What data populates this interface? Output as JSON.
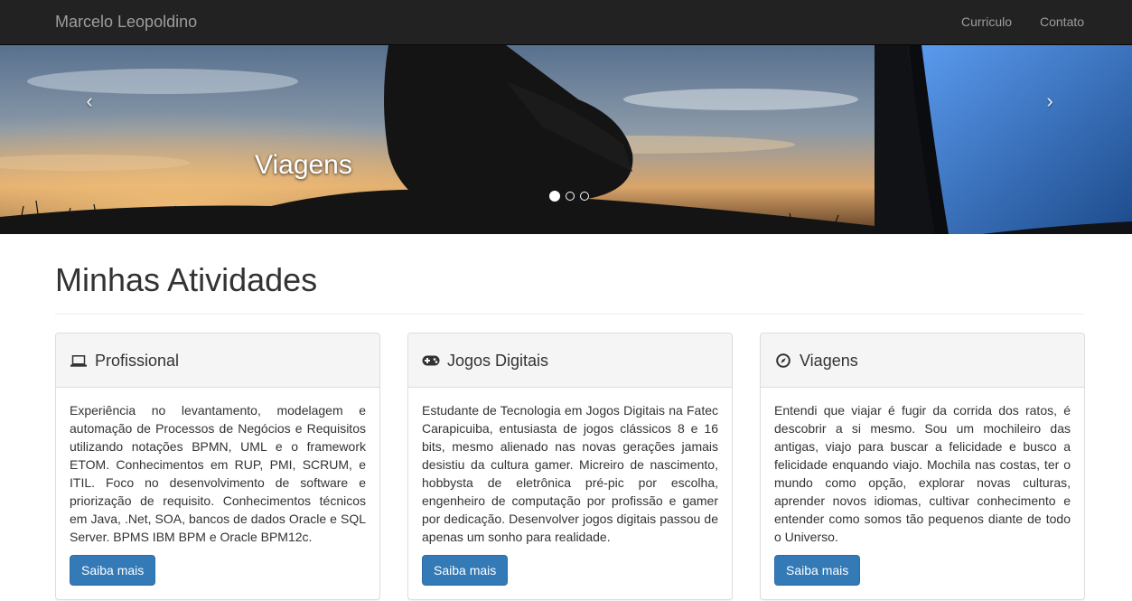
{
  "navbar": {
    "brand": "Marcelo Leopoldino",
    "links": [
      {
        "label": "Curriculo"
      },
      {
        "label": "Contato"
      }
    ]
  },
  "carousel": {
    "caption": "Viagens",
    "prev_glyph": "‹",
    "next_glyph": "›",
    "indicator_count": 3,
    "active_indicator": 0,
    "colors": {
      "sky_top": "#58708f",
      "sky_glow": "#d9a56a",
      "silhouette": "#141414",
      "screen": "#3b7fd8"
    }
  },
  "section": {
    "title": "Minhas Atividades"
  },
  "panels": [
    {
      "icon": "laptop-icon",
      "title": "Profissional",
      "text": "Experiência no levantamento, modelagem e automação de Processos de Negócios e Requisitos utilizando notações BPMN, UML e o framework ETOM. Conhecimentos em RUP, PMI, SCRUM, e ITIL. Foco no desenvolvimento de software e priorização de requisito. Conhecimentos técnicos em Java, .Net, SOA, bancos de dados Oracle e SQL Server. BPMS IBM BPM e Oracle BPM12c.",
      "button": "Saiba mais"
    },
    {
      "icon": "gamepad-icon",
      "title": "Jogos Digitais",
      "text": "Estudante de Tecnologia em Jogos Digitais na Fatec Carapicuiba, entusiasta de jogos clássicos 8 e 16 bits, mesmo alienado nas novas gerações jamais desistiu da cultura gamer. Micreiro de nascimento, hobbysta de eletrônica pré-pic por escolha, engenheiro de computação por profissão e gamer por dedicação. Desenvolver jogos digitais passou de apenas um sonho para realidade.",
      "button": "Saiba mais"
    },
    {
      "icon": "compass-icon",
      "title": "Viagens",
      "text": "Entendi que viajar é fugir da corrida dos ratos, é descobrir a si mesmo. Sou um mochileiro das antigas, viajo para buscar a felicidade e busco a felicidade enquando viajo. Mochila nas costas, ter o mundo como opção, explorar novas culturas, aprender novos idiomas, cultivar conhecimento e entender como somos tão pequenos diante de todo o Universo.",
      "button": "Saiba mais"
    }
  ],
  "colors": {
    "navbar_bg": "#222222",
    "navbar_text": "#9d9d9d",
    "primary": "#337ab7",
    "panel_heading_bg": "#f5f5f5"
  }
}
